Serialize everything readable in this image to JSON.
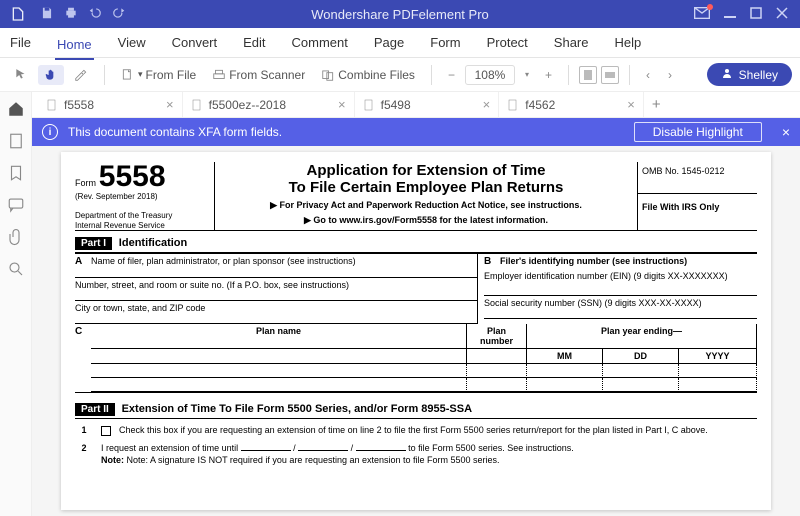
{
  "app": {
    "title": "Wondershare PDFelement Pro",
    "user": "Shelley"
  },
  "menu": {
    "file": "File",
    "home": "Home",
    "view": "View",
    "convert": "Convert",
    "edit": "Edit",
    "comment": "Comment",
    "page": "Page",
    "form": "Form",
    "protect": "Protect",
    "share": "Share",
    "help": "Help"
  },
  "toolbar": {
    "fromFile": "From File",
    "fromScanner": "From Scanner",
    "combineFiles": "Combine Files",
    "zoom": "108%"
  },
  "tabs": [
    {
      "name": "f5558"
    },
    {
      "name": "f5500ez--2018"
    },
    {
      "name": "f5498"
    },
    {
      "name": "f4562"
    }
  ],
  "infobar": {
    "message": "This document contains XFA form fields.",
    "disable": "Disable Highlight"
  },
  "form": {
    "formWord": "Form",
    "number": "5558",
    "rev": "(Rev. September 2018)",
    "dept": "Department of the Treasury\nInternal Revenue Service",
    "title1": "Application for Extension of Time",
    "title2": "To File Certain Employee Plan Returns",
    "note1": "▶ For Privacy Act and Paperwork Reduction Act Notice, see instructions.",
    "note2": "▶ Go to www.irs.gov/Form5558 for the latest information.",
    "omb": "OMB No. 1545-0212",
    "irsOnly": "File With IRS Only",
    "part1Label": "Part I",
    "part1Title": "Identification",
    "A": "A",
    "A_filer": "Name of filer, plan administrator, or plan sponsor (see instructions)",
    "A_addr": "Number, street, and room or suite no. (If a P.O. box, see instructions)",
    "A_city": "City or town, state, and ZIP code",
    "B": "B",
    "B_filerId": "Filer's identifying number (see instructions)",
    "B_ein": "Employer identification number (EIN) (9 digits XX-XXXXXXX)",
    "B_ssn": "Social security number (SSN) (9 digits XXX-XX-XXXX)",
    "C": "C",
    "planName": "Plan name",
    "planNumber": "Plan number",
    "planYearEnding": "Plan year ending—",
    "mm": "MM",
    "dd": "DD",
    "yyyy": "YYYY",
    "part2Label": "Part II",
    "part2Title": "Extension of Time To File Form 5500 Series, and/or Form 8955-SSA",
    "item1num": "1",
    "item1": "Check this box if you are requesting an extension of time on line 2 to file the first Form 5500 series return/report for the plan listed in Part I, C above.",
    "item2num": "2",
    "item2a": "I request an extension of time until",
    "item2b": "to file Form 5500 series. See instructions.",
    "item2note": "Note: A signature IS NOT required if you are requesting an extension to file Form 5500 series."
  }
}
